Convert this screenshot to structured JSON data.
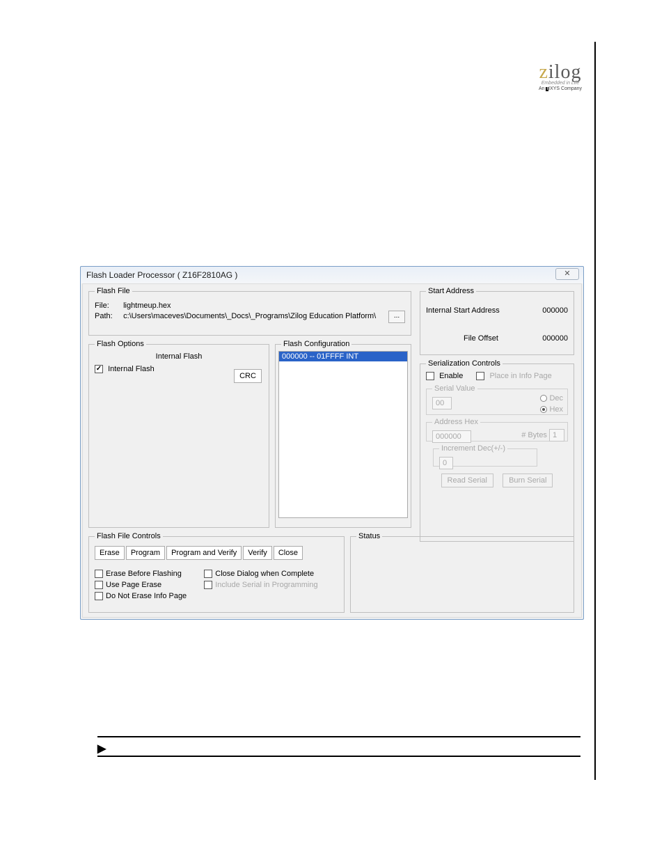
{
  "brand": {
    "name_z": "z",
    "name_ilog": "ilog",
    "tagline1": "Embedded in Life",
    "tagline2_prefix": "An ",
    "tagline2_box": "I",
    "tagline2_rest": "IXYS Company"
  },
  "dialog": {
    "title": "Flash Loader Processor ( Z16F2810AG )",
    "close_x": "✕",
    "flash_file": {
      "legend": "Flash File",
      "file_label": "File:",
      "file_value": "lightmeup.hex",
      "path_label": "Path:",
      "path_value": "c:\\Users\\maceves\\Documents\\_Docs\\_Programs\\Zilog Education Platform\\",
      "browse_label": "..."
    },
    "flash_options": {
      "legend": "Flash Options",
      "header": "Internal Flash",
      "internal_flash_label": "Internal Flash",
      "internal_flash_checked": true,
      "crc_label": "CRC"
    },
    "flash_config": {
      "legend": "Flash Configuration",
      "selected_row": "000000 -- 01FFFF INT"
    },
    "start_address": {
      "legend": "Start Address",
      "internal_label": "Internal Start Address",
      "internal_value": "000000",
      "offset_label": "File Offset",
      "offset_value": "000000"
    },
    "serialization": {
      "legend": "Serialization Controls",
      "enable_label": "Enable",
      "place_label": "Place in Info Page",
      "serial_value_legend": "Serial Value",
      "serial_value": "00",
      "dec_label": "Dec",
      "hex_label": "Hex",
      "address_legend": "Address Hex",
      "address_value": "000000",
      "bytes_label": "# Bytes",
      "bytes_value": "1",
      "increment_legend": "Increment Dec(+/-)",
      "increment_value": "0",
      "read_btn": "Read Serial",
      "burn_btn": "Burn Serial"
    },
    "flash_controls": {
      "legend": "Flash File Controls",
      "buttons": {
        "erase": "Erase",
        "program": "Program",
        "program_verify": "Program and Verify",
        "verify": "Verify",
        "close": "Close"
      },
      "opts": {
        "erase_before": "Erase Before Flashing",
        "use_page_erase": "Use Page Erase",
        "no_erase_info": "Do Not Erase Info Page",
        "close_dialog": "Close Dialog when Complete",
        "include_serial": "Include Serial in Programming"
      }
    },
    "status": {
      "legend": "Status"
    }
  }
}
